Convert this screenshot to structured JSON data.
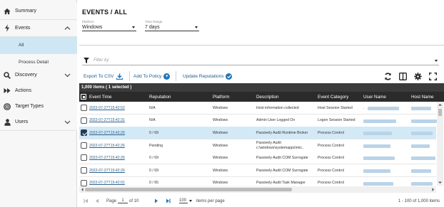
{
  "sidebar": {
    "items": [
      {
        "label": "Summary",
        "icon": "home-icon"
      },
      {
        "label": "Events",
        "icon": "bolt-icon",
        "expanded": true
      },
      {
        "label": "Discovery",
        "icon": "search-icon"
      },
      {
        "label": "Actions",
        "icon": "fast-forward-icon"
      },
      {
        "label": "Target Types",
        "icon": "target-icon"
      },
      {
        "label": "Users",
        "icon": "user-icon"
      }
    ],
    "subitems": [
      {
        "label": "All",
        "active": true
      },
      {
        "label": "Process Detail",
        "active": false
      }
    ]
  },
  "header": {
    "title": "EVENTS / ALL",
    "platform_label": "Platform",
    "platform_value": "Windows",
    "time_range_label": "Time Range",
    "time_range_value": "7 days"
  },
  "filter": {
    "placeholder": "Filter by"
  },
  "toolbar": {
    "export_label": "Export To CSV",
    "add_policy_label": "Add To Policy",
    "update_reputations_label": "Update Reputations"
  },
  "grid": {
    "count_text": "1,000 items ( 1 selected )",
    "columns": [
      "Event Time",
      "Reputation",
      "Platform",
      "Description",
      "Event Category",
      "User Name",
      "Host Name"
    ],
    "rows": [
      {
        "time": "2022-07-27T15:42:52",
        "reputation": "N/A",
        "platform": "Windows",
        "description": "Host information collected",
        "category": "Host Session Started",
        "user": ".",
        "selected": false
      },
      {
        "time": "2022-07-27T15:42:31",
        "reputation": "N/A",
        "platform": "Windows",
        "description": "Admin User Logged On",
        "category": "Logon Session Started",
        "user": "",
        "selected": false
      },
      {
        "time": "2022-07-27T15:42:26",
        "reputation": "0 / 69",
        "platform": "Windows",
        "description": "Passively Audit Runtime Broker",
        "category": "Process Control",
        "user": "",
        "selected": true
      },
      {
        "time": "2022-07-27T15:42:26",
        "reputation": "Pending",
        "platform": "Windows",
        "description": "Passively Audit c:\\windows\\systemapps\\mic..",
        "category": "Process Control",
        "user": "",
        "selected": false
      },
      {
        "time": "2022-07-27T15:42:26",
        "reputation": "0 / 69",
        "platform": "Windows",
        "description": "Passively Audit COM Surrogate",
        "category": "Process Control",
        "user": "",
        "selected": false
      },
      {
        "time": "2022-07-27T15:42:26",
        "reputation": "0 / 69",
        "platform": "Windows",
        "description": "Passively Audit COM Surrogate",
        "category": "Process Control",
        "user": "",
        "selected": false
      },
      {
        "time": "2022-07-27T15:42:01",
        "reputation": "0 / 65",
        "platform": "Windows",
        "description": "Passively Audit Task Manager",
        "category": "Process Control",
        "user": "",
        "selected": false
      }
    ]
  },
  "pager": {
    "page_label": "Page",
    "page_value": "1",
    "of_label": "of 10",
    "per_page_value": "100",
    "per_page_label": "items per page",
    "range_text": "1 - 100 of 1,000 items"
  },
  "colors": {
    "accent": "#1f74b8",
    "selected_row": "#d3e9f6",
    "header_dark": "#2b2b2b"
  }
}
